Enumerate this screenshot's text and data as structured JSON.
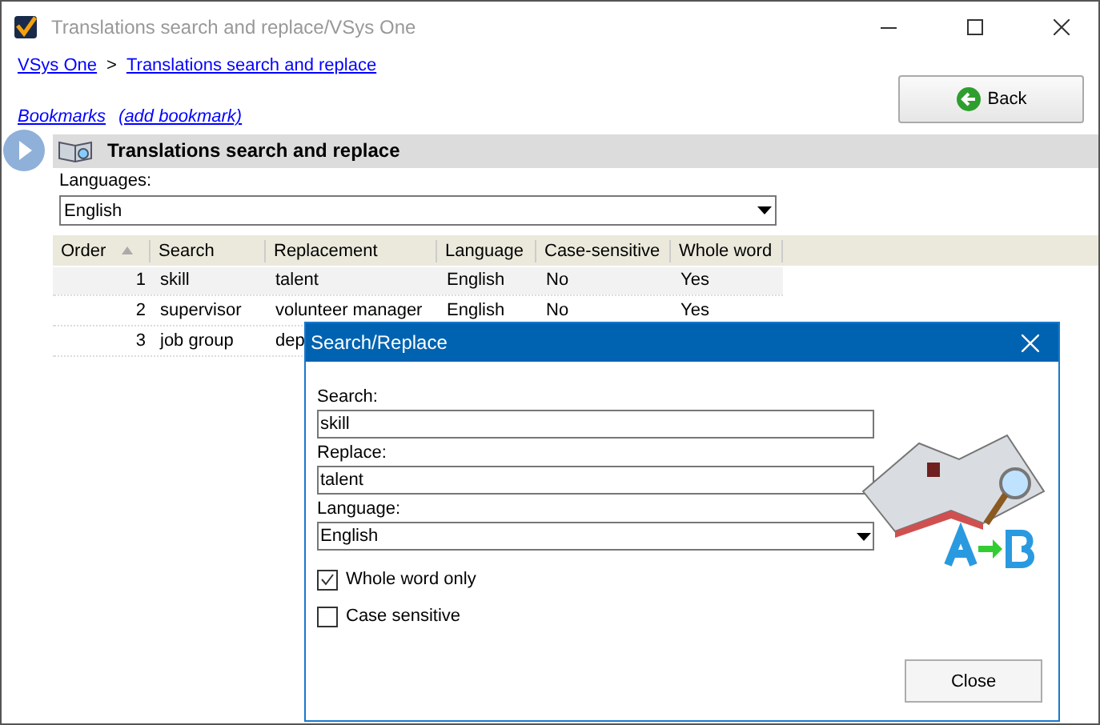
{
  "window": {
    "title": "Translations search and replace/VSys One"
  },
  "breadcrumbs": [
    {
      "label": "VSys One"
    },
    {
      "label": "Translations search and replace"
    }
  ],
  "breadcrumb_separator": ">",
  "bookmarks": [
    "Bookmarks",
    "(add bookmark)"
  ],
  "back_button": "Back",
  "header": {
    "title": "Translations search and replace"
  },
  "languages": {
    "label": "Languages:",
    "value": "English"
  },
  "table": {
    "columns": [
      "Order",
      "Search",
      "Replacement",
      "Language",
      "Case-sensitive",
      "Whole word"
    ],
    "rows": [
      {
        "selected": true,
        "cells": [
          "1",
          "skill",
          "talent",
          "English",
          "No",
          "Yes"
        ]
      },
      {
        "selected": false,
        "cells": [
          "2",
          "supervisor",
          "volunteer manager",
          "English",
          "No",
          "Yes"
        ]
      },
      {
        "selected": false,
        "cells": [
          "3",
          "job group",
          "dep"
        ]
      }
    ]
  },
  "dialog": {
    "title": "Search/Replace",
    "search": {
      "label": "Search:",
      "value": "skill"
    },
    "replace": {
      "label": "Replace:",
      "value": "talent"
    },
    "language": {
      "label": "Language:",
      "value": "English"
    },
    "checkboxes": [
      {
        "label": "Whole word only",
        "checked": true
      },
      {
        "label": "Case sensitive",
        "checked": false
      }
    ],
    "close_button": "Close"
  }
}
